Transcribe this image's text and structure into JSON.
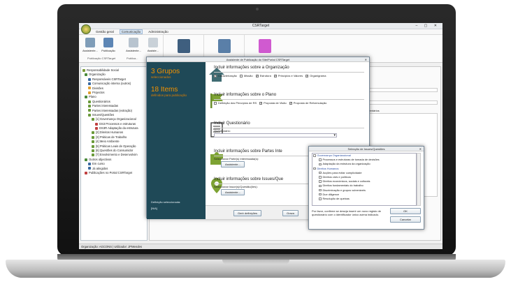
{
  "window": {
    "title": "CSRTarget",
    "controls": "–  ▢  ✕"
  },
  "menu": {
    "items": [
      "Gestão geral",
      "Comunicação",
      "Administração"
    ],
    "active_index": 1
  },
  "ribbon": {
    "buttons": [
      {
        "label": "Assistente..."
      },
      {
        "label": "Publicação"
      },
      {
        "label": "Assistente..."
      },
      {
        "label": "Assiste..."
      }
    ],
    "group_label": "Publicação CSRTarget",
    "group_label_2": "Publica..."
  },
  "tree": {
    "items": [
      {
        "level": 0,
        "label": "Responsabilidade Social",
        "color": "#7a9a3a"
      },
      {
        "level": 1,
        "label": "Organização",
        "color": "#4a8a3a"
      },
      {
        "level": 2,
        "label": "Responsáveis CSRTarget",
        "color": "#3a6aa0"
      },
      {
        "level": 2,
        "label": "Comunicação interna (outros)",
        "color": "#3a6aa0"
      },
      {
        "level": 2,
        "label": "Divisões",
        "color": "#e0a030"
      },
      {
        "level": 2,
        "label": "Projectos",
        "color": "#e0a030"
      },
      {
        "level": 1,
        "label": "Plano",
        "color": "#4a8a3a"
      },
      {
        "level": 2,
        "label": "Questionários",
        "color": "#6a9a3a"
      },
      {
        "level": 2,
        "label": "Partes interessadas",
        "color": "#6a9a3a"
      },
      {
        "level": 2,
        "label": "Partes interessadas (extração)",
        "color": "#6a9a3a"
      },
      {
        "level": 2,
        "label": "Issues/Questões",
        "color": "#6a9a3a"
      },
      {
        "level": 3,
        "label": "[1] Governança Organizacional",
        "color": "#6a9a3a"
      },
      {
        "level": 4,
        "label": "DS3 Processos e estruturas",
        "color": "#c04040"
      },
      {
        "level": 4,
        "label": "DS3R Adaptação da estrutura",
        "color": "#c04040"
      },
      {
        "level": 3,
        "label": "[2] Direitos Humanos",
        "color": "#6a9a3a"
      },
      {
        "level": 3,
        "label": "[3] Práticas de Trabalho",
        "color": "#6a9a3a"
      },
      {
        "level": 3,
        "label": "[4] Meio Ambiente",
        "color": "#6a9a3a"
      },
      {
        "level": 3,
        "label": "[5] Práticas Leais de Operação",
        "color": "#6a9a3a"
      },
      {
        "level": 3,
        "label": "[6] Questões do Consumidor",
        "color": "#6a9a3a"
      },
      {
        "level": 3,
        "label": "[7] Envolvimento e Desenvolvim",
        "color": "#6a9a3a"
      },
      {
        "level": 1,
        "label": "Outros objectivos",
        "color": "#4a8a3a"
      },
      {
        "level": 2,
        "label": "Em curso",
        "color": "#3a6aa0"
      },
      {
        "level": 2,
        "label": "Já atingidos",
        "color": "#3a6aa0"
      },
      {
        "level": 1,
        "label": "Publicações no Portal CSRTarget",
        "color": "#c04040"
      }
    ]
  },
  "status": {
    "text": "Organização: AGCONS  |  Utilizador: JPMendes"
  },
  "right_panel": {
    "col_header": "Comentários",
    "partial_label": "...es"
  },
  "dialog": {
    "title": "Assistente de Publicação do Site/Portal CSRTarget",
    "groups_count": "3 Grupos",
    "groups_label": "seleccionados",
    "items_count": "18 Items",
    "items_label": "definidos para publicação",
    "def_label": "Definição seleccionada:",
    "def_value": "[N/A]",
    "sections": {
      "org": {
        "title": "Incluir informações sobre a Organização",
        "checks": [
          {
            "label": "Caracterização",
            "checked": true
          },
          {
            "label": "Missão",
            "checked": false
          },
          {
            "label": "Estrutura",
            "checked": true
          },
          {
            "label": "Princípios e Valores",
            "checked": true
          },
          {
            "label": "Organigrama",
            "checked": true
          }
        ]
      },
      "plan": {
        "title": "Incluir informações sobre o Plano",
        "checks": [
          {
            "label": "Definição dos Princípios de RS",
            "checked": false
          },
          {
            "label": "Proposta de Visão",
            "checked": true
          },
          {
            "label": "Proposta de Reformulação",
            "checked": true
          }
        ]
      },
      "quest": {
        "title": "Incluir Questionário",
        "field_label": "Questionário:"
      },
      "parts": {
        "title": "Incluir informações sobre Partes Inte",
        "field_label": "Seleccionar Parte(s) Interessada(s):",
        "button": "Assistente..."
      },
      "issues": {
        "title": "Incluir informações sobre Issues/Que",
        "field_label": "Seleccionar Issue(s)/Questão(ões):",
        "button": "Assistente..."
      }
    },
    "footer": {
      "manage": "Gerir definições",
      "save": "Grava"
    }
  },
  "popup": {
    "title": "Selecção de Issues/Questões",
    "items": [
      {
        "type": "cat",
        "label": "Governança Organizacional"
      },
      {
        "type": "it",
        "label": "Processos e estruturas de tomada de decisões"
      },
      {
        "type": "it",
        "label": "Adaptação da estrutura da organização"
      },
      {
        "type": "cat",
        "label": "Direitos Humanos"
      },
      {
        "type": "it",
        "label": "Acções para evitar cumplicidade"
      },
      {
        "type": "it",
        "label": "Direitos civis e políticos"
      },
      {
        "type": "it",
        "label": "Direitos económicos, sociais e culturais"
      },
      {
        "type": "it",
        "label": "Direitos fundamentais do trabalho"
      },
      {
        "type": "it",
        "label": "Discriminação e grupos vulneráveis"
      },
      {
        "type": "it",
        "label": "Due diligence"
      },
      {
        "type": "it",
        "label": "Resolução de queixas"
      }
    ],
    "note": "Por favor, confirme se deseja inserir um novo registo de questionário com o identificador único acima indicado.",
    "ok": "OK",
    "cancel": "Cancelar"
  }
}
